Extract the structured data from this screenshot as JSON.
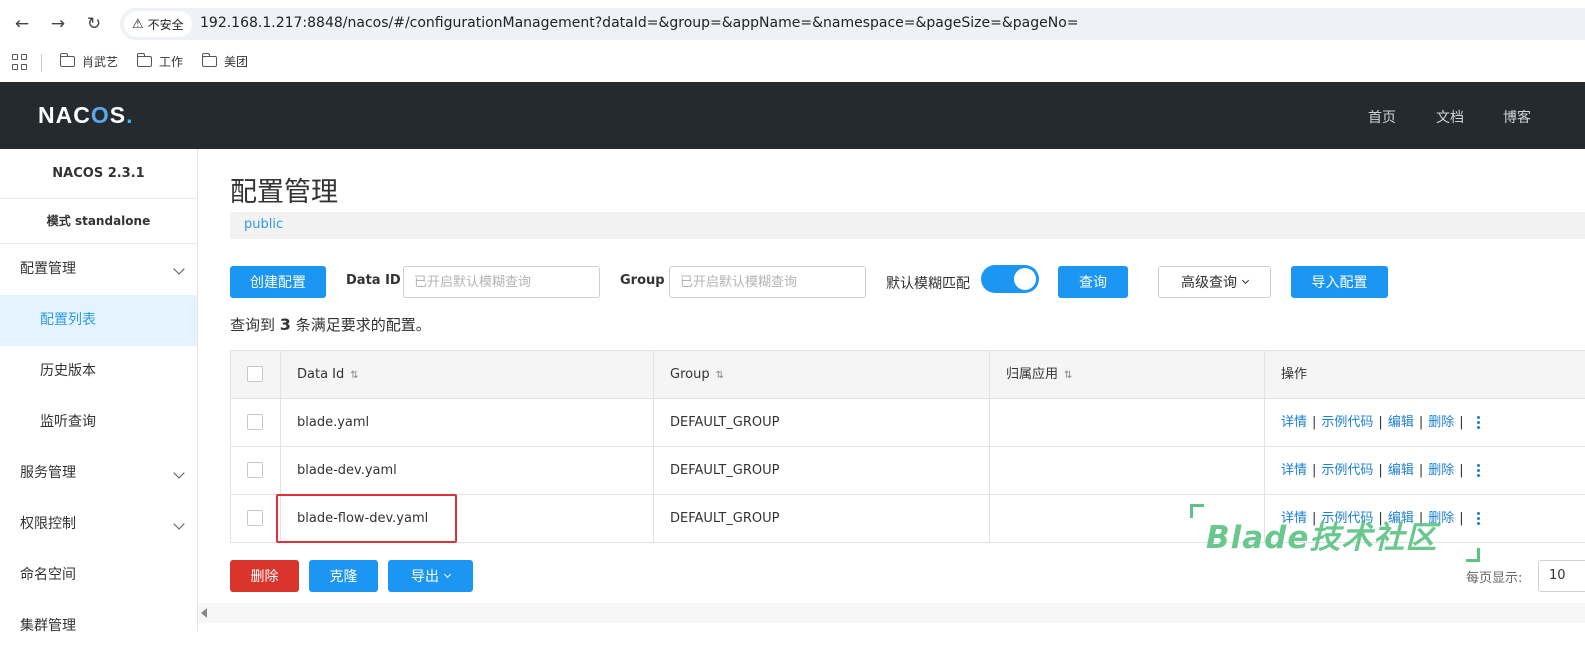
{
  "browser": {
    "security_label": "不安全",
    "url": "192.168.1.217:8848/nacos/#/configurationManagement?dataId=&group=&appName=&namespace=&pageSize=&pageNo=",
    "bookmarks": [
      "肖武艺",
      "工作",
      "美团"
    ]
  },
  "header": {
    "logo": "NACOS",
    "nav": [
      "首页",
      "文档",
      "博客"
    ]
  },
  "sidebar": {
    "version": "NACOS 2.3.1",
    "mode": "模式 standalone",
    "items": [
      {
        "label": "配置管理"
      },
      {
        "label": "配置列表"
      },
      {
        "label": "历史版本"
      },
      {
        "label": "监听查询"
      },
      {
        "label": "服务管理"
      },
      {
        "label": "权限控制"
      },
      {
        "label": "命名空间"
      },
      {
        "label": "集群管理"
      }
    ]
  },
  "main": {
    "title": "配置管理",
    "namespace": "public",
    "create_button": "创建配置",
    "data_id_label": "Data ID",
    "data_id_placeholder": "已开启默认模糊查询",
    "group_label": "Group",
    "group_placeholder": "已开启默认模糊查询",
    "fuzzy_label": "默认模糊匹配",
    "fuzzy_enabled": true,
    "query_button": "查询",
    "advanced_button": "高级查询",
    "import_button": "导入配置",
    "result_prefix": "查询到",
    "result_count": "3",
    "result_suffix": "条满足要求的配置。"
  },
  "table": {
    "headers": [
      "Data Id",
      "Group",
      "归属应用",
      "操作"
    ],
    "rows": [
      {
        "data_id": "blade.yaml",
        "group": "DEFAULT_GROUP",
        "app": ""
      },
      {
        "data_id": "blade-dev.yaml",
        "group": "DEFAULT_GROUP",
        "app": ""
      },
      {
        "data_id": "blade-flow-dev.yaml",
        "group": "DEFAULT_GROUP",
        "app": ""
      }
    ],
    "actions": [
      "详情",
      "示例代码",
      "编辑",
      "删除"
    ]
  },
  "footer": {
    "delete_button": "删除",
    "clone_button": "克隆",
    "export_button": "导出",
    "page_size_label": "每页显示:",
    "page_size_value": "10"
  },
  "watermark": "Blade技术社区",
  "colors": {
    "primary": "#1b96f2",
    "danger": "#d9352c",
    "header_bg": "#252a2f",
    "highlight_border": "#e0303a",
    "watermark": "#5ec486"
  }
}
